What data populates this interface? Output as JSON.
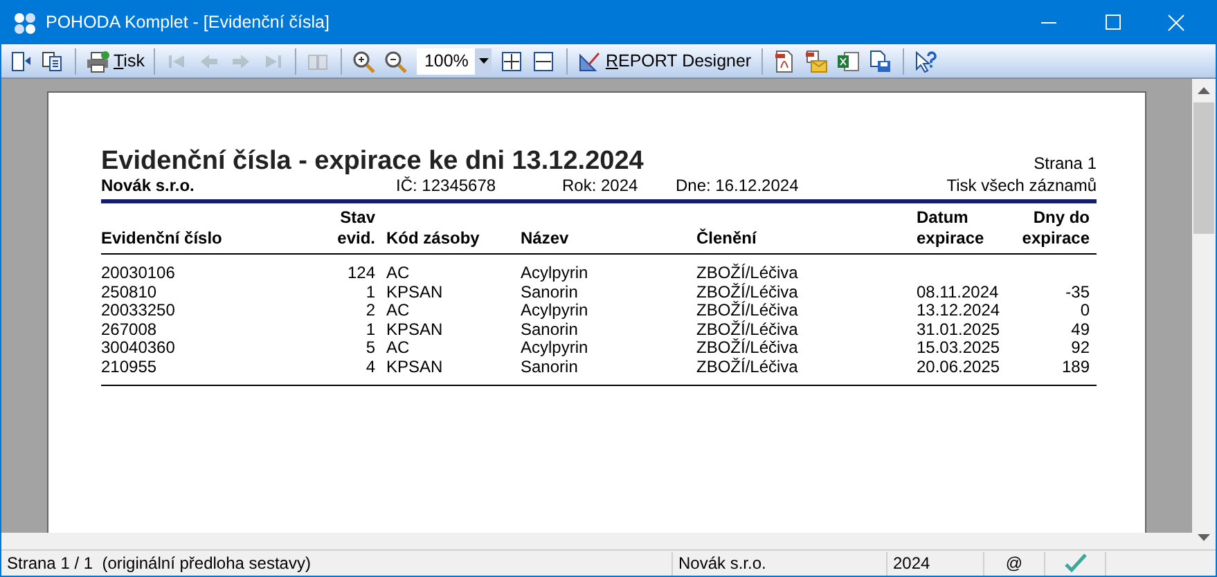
{
  "window": {
    "title": "POHODA Komplet - [Evidenční čísla]"
  },
  "toolbar": [
    {
      "kind": "button",
      "disabled": false
    },
    {
      "kind": "button",
      "disabled": false
    },
    {
      "kind": "sep"
    },
    {
      "kind": "button",
      "label": "Tisk",
      "disabled": false
    },
    {
      "kind": "sep"
    },
    {
      "kind": "button",
      "disabled": true
    },
    {
      "kind": "button",
      "disabled": true
    },
    {
      "kind": "button",
      "disabled": true
    },
    {
      "kind": "button",
      "disabled": true
    },
    {
      "kind": "sep"
    },
    {
      "kind": "button",
      "disabled": true
    },
    {
      "kind": "sep"
    },
    {
      "kind": "button",
      "disabled": false
    },
    {
      "kind": "button",
      "disabled": false
    },
    {
      "kind": "zoom",
      "value": "100%"
    },
    {
      "kind": "button",
      "disabled": false
    },
    {
      "kind": "button",
      "disabled": false
    },
    {
      "kind": "sep"
    },
    {
      "kind": "button",
      "label": "REPORT Designer",
      "disabled": false
    },
    {
      "kind": "sep"
    },
    {
      "kind": "button",
      "disabled": false
    },
    {
      "kind": "button",
      "disabled": false
    },
    {
      "kind": "button",
      "disabled": false
    },
    {
      "kind": "button",
      "disabled": false
    },
    {
      "kind": "sep"
    },
    {
      "kind": "button",
      "disabled": false
    }
  ],
  "report": {
    "title": "Evidenční čísla - expirace ke dni 13.12.2024",
    "page": "Strana 1",
    "company": "Novák s.r.o.",
    "ic": "IČ: 12345678",
    "year": "Rok: 2024",
    "date": "Dne: 16.12.2024",
    "scope": "Tisk všech záznamů",
    "columns": [
      "Evidenční číslo",
      "Stav evid.",
      "Kód zásoby",
      "Název",
      "Členění",
      "Datum expirace",
      "Dny do expirace"
    ],
    "rows": [
      [
        "20030106",
        "124",
        "AC",
        "Acylpyrin",
        "ZBOŽÍ/Léčiva",
        "",
        ""
      ],
      [
        "250810",
        "1",
        "KPSAN",
        "Sanorin",
        "ZBOŽÍ/Léčiva",
        "08.11.2024",
        "-35"
      ],
      [
        "20033250",
        "2",
        "AC",
        "Acylpyrin",
        "ZBOŽÍ/Léčiva",
        "13.12.2024",
        "0"
      ],
      [
        "267008",
        "1",
        "KPSAN",
        "Sanorin",
        "ZBOŽÍ/Léčiva",
        "31.01.2025",
        "49"
      ],
      [
        "30040360",
        "5",
        "AC",
        "Acylpyrin",
        "ZBOŽÍ/Léčiva",
        "15.03.2025",
        "92"
      ],
      [
        "210955",
        "4",
        "KPSAN",
        "Sanorin",
        "ZBOŽÍ/Léčiva",
        "20.06.2025",
        "189"
      ]
    ]
  },
  "status_bar": {
    "pages": "Strana 1 / 1  (originální předloha sestavy)",
    "company": "Novák s.r.o.",
    "year": "2024",
    "at": "@",
    "ok": true
  }
}
